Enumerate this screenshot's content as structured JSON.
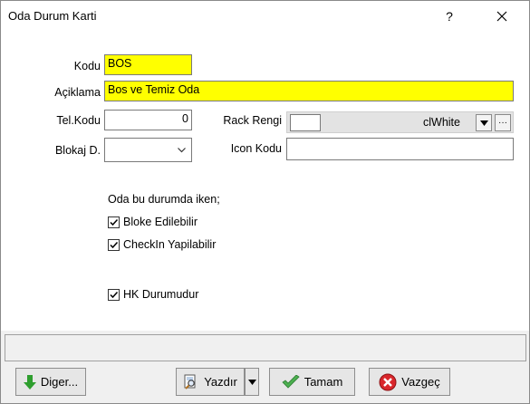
{
  "window": {
    "title": "Oda Durum Karti",
    "help_glyph": "?",
    "close_glyph": "✕"
  },
  "form": {
    "kodu": {
      "label": "Kodu",
      "value": "BOS"
    },
    "aciklama": {
      "label": "Açiklama",
      "value": "Bos ve Temiz Oda"
    },
    "tel_kodu": {
      "label": "Tel.Kodu",
      "value": "0"
    },
    "blokaj": {
      "label": "Blokaj D.",
      "value": ""
    },
    "rack_rengi": {
      "label": "Rack Rengi",
      "value": "clWhite",
      "swatch_color": "#ffffff",
      "ellipsis": "···"
    },
    "icon_kodu": {
      "label": "Icon Kodu",
      "value": ""
    }
  },
  "options": {
    "heading": "Oda bu durumda iken;",
    "bloke": {
      "label": "Bloke Edilebilir",
      "checked": true
    },
    "checkin": {
      "label": "CheckIn Yapilabilir",
      "checked": true
    },
    "hk": {
      "label": "HK Durumudur",
      "checked": true
    }
  },
  "status": {
    "text": ""
  },
  "buttons": {
    "diger": "Diger...",
    "yazdir": "Yazdır",
    "tamam": "Tamam",
    "vazgec": "Vazgeç"
  },
  "colors": {
    "highlight_field": "#ffff00",
    "ok_icon": "#4caf50",
    "cancel_icon": "#d9262b",
    "diger_arrow": "#2e9e2e"
  }
}
